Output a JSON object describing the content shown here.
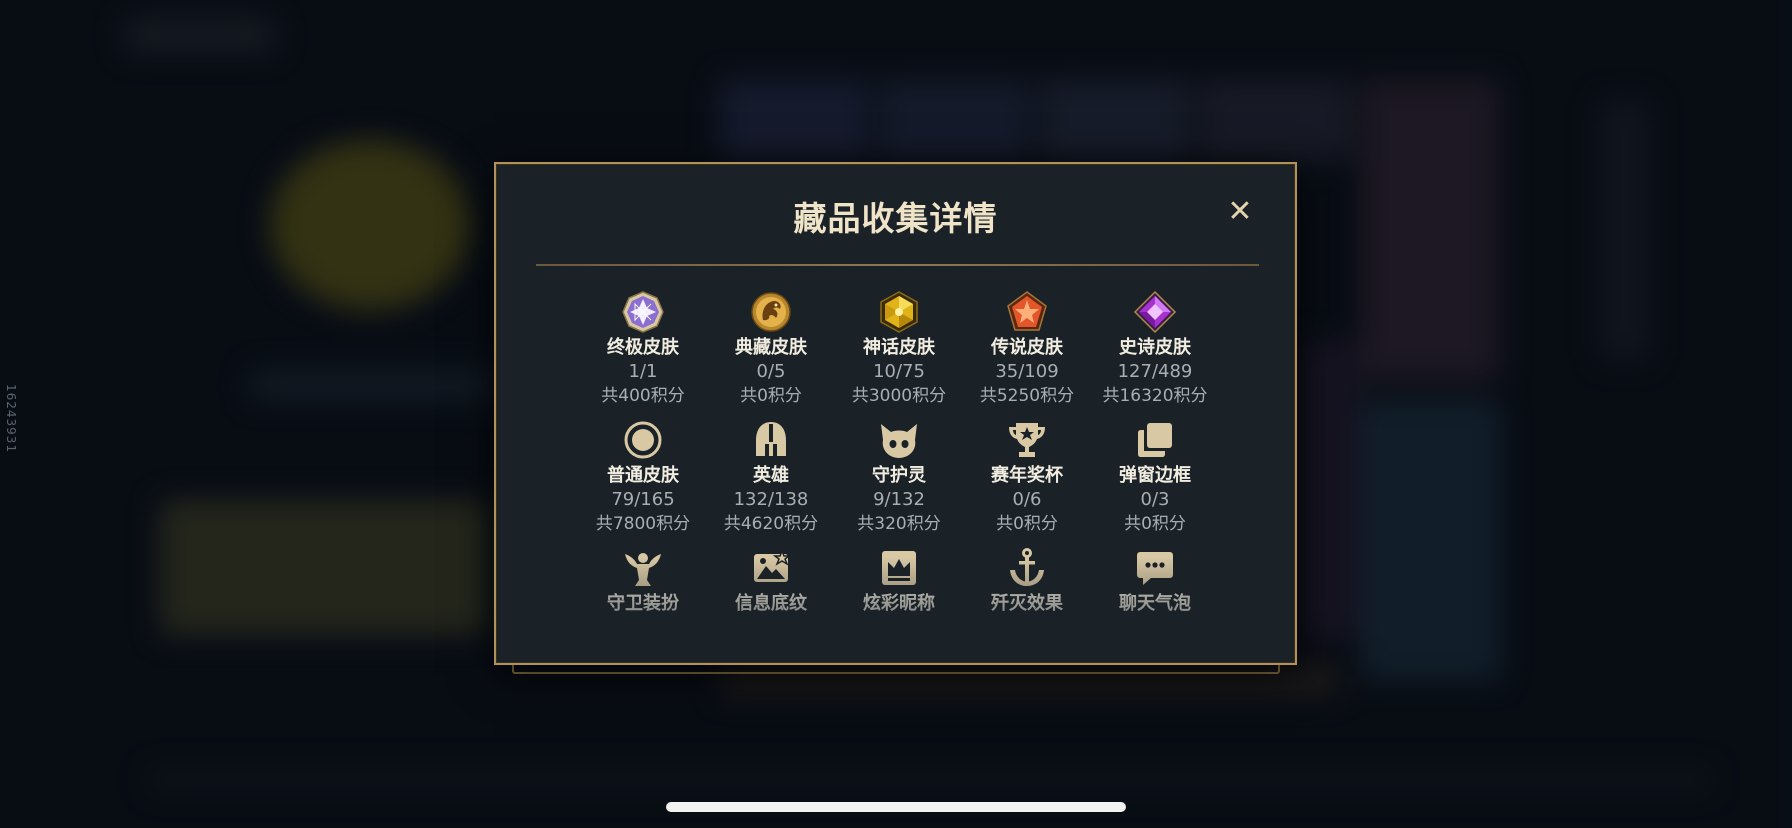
{
  "side_id": "16243931",
  "modal": {
    "title": "藏品收集详情",
    "close_label": "✕"
  },
  "items": [
    {
      "name": "终极皮肤",
      "count": "1/1",
      "points": "共400积分",
      "icon": "ultimate-skin-icon"
    },
    {
      "name": "典藏皮肤",
      "count": "0/5",
      "points": "共0积分",
      "icon": "prestige-skin-icon"
    },
    {
      "name": "神话皮肤",
      "count": "10/75",
      "points": "共3000积分",
      "icon": "mythic-skin-icon"
    },
    {
      "name": "传说皮肤",
      "count": "35/109",
      "points": "共5250积分",
      "icon": "legendary-skin-icon"
    },
    {
      "name": "史诗皮肤",
      "count": "127/489",
      "points": "共16320积分",
      "icon": "epic-skin-icon"
    },
    {
      "name": "普通皮肤",
      "count": "79/165",
      "points": "共7800积分",
      "icon": "normal-skin-icon"
    },
    {
      "name": "英雄",
      "count": "132/138",
      "points": "共4620积分",
      "icon": "champion-helmet-icon"
    },
    {
      "name": "守护灵",
      "count": "9/132",
      "points": "共320积分",
      "icon": "little-legend-icon"
    },
    {
      "name": "赛年奖杯",
      "count": "0/6",
      "points": "共0积分",
      "icon": "trophy-icon"
    },
    {
      "name": "弹窗边框",
      "count": "0/3",
      "points": "共0积分",
      "icon": "popup-frame-icon"
    },
    {
      "name": "守卫装扮",
      "count": "",
      "points": "",
      "icon": "ward-skin-icon"
    },
    {
      "name": "信息底纹",
      "count": "",
      "points": "",
      "icon": "banner-icon"
    },
    {
      "name": "炫彩昵称",
      "count": "",
      "points": "",
      "icon": "nickname-crown-icon"
    },
    {
      "name": "歼灭效果",
      "count": "",
      "points": "",
      "icon": "anchor-icon"
    },
    {
      "name": "聊天气泡",
      "count": "",
      "points": "",
      "icon": "chat-bubble-icon"
    }
  ],
  "colors": {
    "panel_bg": "#1a2127",
    "gold_border": "#b0925a",
    "title": "#efe3c8",
    "label": "#f1ece0",
    "secondary": "#a9aeb2",
    "glyph_tan": "#d8c8a4"
  }
}
